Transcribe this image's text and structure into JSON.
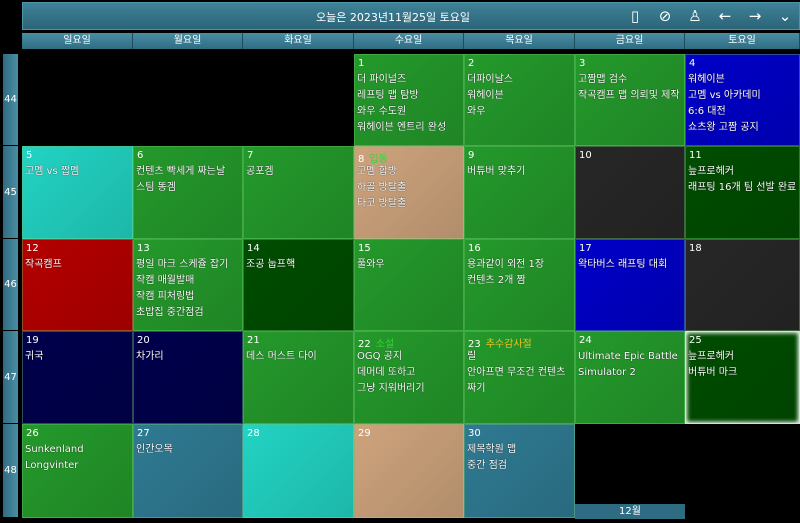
{
  "header": {
    "title": "오늘은 2023년11월25일 토요일",
    "icons": [
      "mobile-icon",
      "sync-icon",
      "user-icon",
      "arrow-left-icon",
      "arrow-right-icon",
      "chevron-down-icon"
    ],
    "glyphs": [
      "▯",
      "⊘",
      "♙",
      "←",
      "→",
      "⌄"
    ]
  },
  "weekdays": [
    "일요일",
    "월요일",
    "화요일",
    "수요일",
    "목요일",
    "금요일",
    "토요일"
  ],
  "weeks": [
    "44",
    "45",
    "46",
    "47",
    "48"
  ],
  "colors": {
    "green": "#24992b",
    "blue": "#0000c8",
    "cyan": "#22d3c3",
    "tan": "#cda37c",
    "red": "#b40000",
    "darkgreen": "#004d00",
    "gray": "#272727",
    "navy": "#00004c",
    "teal": "#2f7a92",
    "holiday_green": "#3fcf3f",
    "holiday_yellow": "#e8c020"
  },
  "days": [
    {
      "day": "1",
      "col": 3,
      "row": 0,
      "color": "green",
      "events": [
        "더 파이널즈",
        "레프팅 맵 탐방",
        "와우 수도원",
        "워헤이븐 엔트리 완성"
      ]
    },
    {
      "day": "2",
      "col": 4,
      "row": 0,
      "color": "green",
      "events": [
        "더파이날스",
        "워헤이븐",
        "와우"
      ]
    },
    {
      "day": "3",
      "col": 5,
      "row": 0,
      "color": "green",
      "events": [
        "고짬맵 검수",
        "작곡캠프 맵 의뢰및 제작"
      ]
    },
    {
      "day": "4",
      "col": 6,
      "row": 0,
      "color": "blue",
      "events": [
        "워헤이븐",
        "고멤 vs 아카데미",
        "6:6 대전",
        "쇼츠왕 고짬 공지"
      ]
    },
    {
      "day": "5",
      "col": 0,
      "row": 1,
      "color": "cyan",
      "events": [
        "고멤 vs 짭멤"
      ]
    },
    {
      "day": "6",
      "col": 1,
      "row": 1,
      "color": "green",
      "events": [
        "컨텐츠 빡세게 짜는날",
        "스팀 똥겜"
      ]
    },
    {
      "day": "7",
      "col": 2,
      "row": 1,
      "color": "green",
      "events": [
        "공포겜"
      ]
    },
    {
      "day": "8",
      "col": 3,
      "row": 1,
      "color": "tan",
      "holiday": "입동",
      "holiday_color": "holiday_green",
      "events": [
        "고멤 합방",
        "하골 방탈출",
        "타코 방탈출"
      ]
    },
    {
      "day": "9",
      "col": 4,
      "row": 1,
      "color": "green",
      "events": [
        "버튜버 맞추기"
      ]
    },
    {
      "day": "10",
      "col": 5,
      "row": 1,
      "color": "gray",
      "events": []
    },
    {
      "day": "11",
      "col": 6,
      "row": 1,
      "color": "darkgreen",
      "events": [
        "늪프로헤커",
        "래프팅 16개 팀 선발 완료"
      ]
    },
    {
      "day": "12",
      "col": 0,
      "row": 2,
      "color": "red",
      "events": [
        "작곡캠프"
      ]
    },
    {
      "day": "13",
      "col": 1,
      "row": 2,
      "color": "green",
      "events": [
        "평일 마크 스케쥴 잡기",
        "작캠 매월발매",
        "작캠 피처링법",
        "초밥집 중간점검"
      ]
    },
    {
      "day": "14",
      "col": 2,
      "row": 2,
      "color": "darkgreen",
      "events": [
        "조공 눕프핵"
      ]
    },
    {
      "day": "15",
      "col": 3,
      "row": 2,
      "color": "green",
      "events": [
        "풀와우"
      ]
    },
    {
      "day": "16",
      "col": 4,
      "row": 2,
      "color": "green",
      "events": [
        "용과같이 외전 1장",
        "컨텐츠 2개 짬"
      ]
    },
    {
      "day": "17",
      "col": 5,
      "row": 2,
      "color": "blue",
      "events": [
        "왁타버스 래프팅 대회"
      ]
    },
    {
      "day": "18",
      "col": 6,
      "row": 2,
      "color": "gray",
      "events": []
    },
    {
      "day": "19",
      "col": 0,
      "row": 3,
      "color": "navy",
      "events": [
        "귀국"
      ]
    },
    {
      "day": "20",
      "col": 1,
      "row": 3,
      "color": "navy",
      "events": [
        "차가리"
      ]
    },
    {
      "day": "21",
      "col": 2,
      "row": 3,
      "color": "green",
      "events": [
        "데스 머스트 다이"
      ]
    },
    {
      "day": "22",
      "col": 3,
      "row": 3,
      "color": "green",
      "holiday": "소설",
      "holiday_color": "holiday_green",
      "events": [
        "OGQ 공지",
        "데머데 또하고",
        "그냥 지워버리기"
      ]
    },
    {
      "day": "23",
      "col": 4,
      "row": 3,
      "color": "green",
      "holiday": "추수감사절",
      "holiday_color": "holiday_yellow",
      "events": [
        "릴",
        "안아프면 무조건 컨텐츠",
        "짜기"
      ]
    },
    {
      "day": "24",
      "col": 5,
      "row": 3,
      "color": "green",
      "events": [
        "Ultimate Epic Battle",
        "Simulator 2"
      ]
    },
    {
      "day": "25",
      "col": 6,
      "row": 3,
      "color": "darkgreen",
      "today": true,
      "events": [
        "늪프로헤커",
        "버튜버 마크"
      ]
    },
    {
      "day": "26",
      "col": 0,
      "row": 4,
      "color": "green",
      "events": [
        "Sunkenland",
        "Longvinter"
      ]
    },
    {
      "day": "27",
      "col": 1,
      "row": 4,
      "color": "teal",
      "events": [
        "인간오목"
      ]
    },
    {
      "day": "28",
      "col": 2,
      "row": 4,
      "color": "cyan",
      "events": []
    },
    {
      "day": "29",
      "col": 3,
      "row": 4,
      "color": "tan",
      "events": []
    },
    {
      "day": "30",
      "col": 4,
      "row": 4,
      "color": "teal",
      "events": [
        "제목학원 맵",
        "중간 점검"
      ]
    }
  ],
  "next_month_label": "12월"
}
